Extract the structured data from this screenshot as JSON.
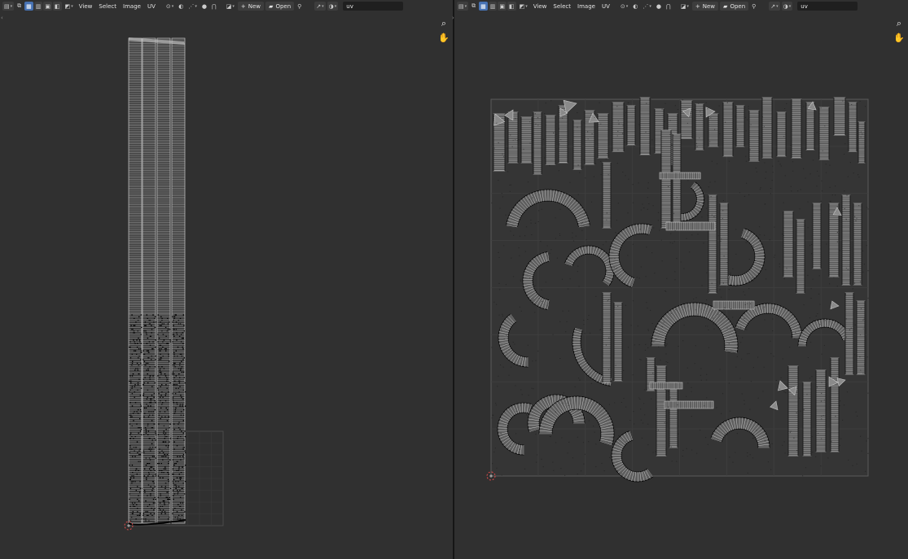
{
  "colors": {
    "bg": "#303030",
    "grid": "#3a3a3a",
    "uv": "#c9c9c9",
    "vertex": "#000000",
    "cursor": "#e24c4c"
  },
  "icons": {
    "editor_type": "image-editor-icon",
    "view_mode": "uv-mode-icon",
    "sync": "select-mode-icon",
    "pivot": "pivot-icon",
    "snap": "snap-icon",
    "proportional": "proportional-edit-icon",
    "new": "plus-icon",
    "open": "folder-icon",
    "pin": "pin-icon",
    "gizmo": "gizmo-icon",
    "overlay": "overlay-icon",
    "zoom": "zoom-icon",
    "pan": "hand-icon"
  },
  "left": {
    "menus": [
      "View",
      "Select",
      "Image",
      "UV"
    ],
    "new_label": "New",
    "open_label": "Open",
    "image_name": "uv"
  },
  "right": {
    "menus": [
      "View",
      "Select",
      "Image",
      "UV"
    ],
    "new_label": "New",
    "open_label": "Open",
    "image_name": "uv"
  }
}
